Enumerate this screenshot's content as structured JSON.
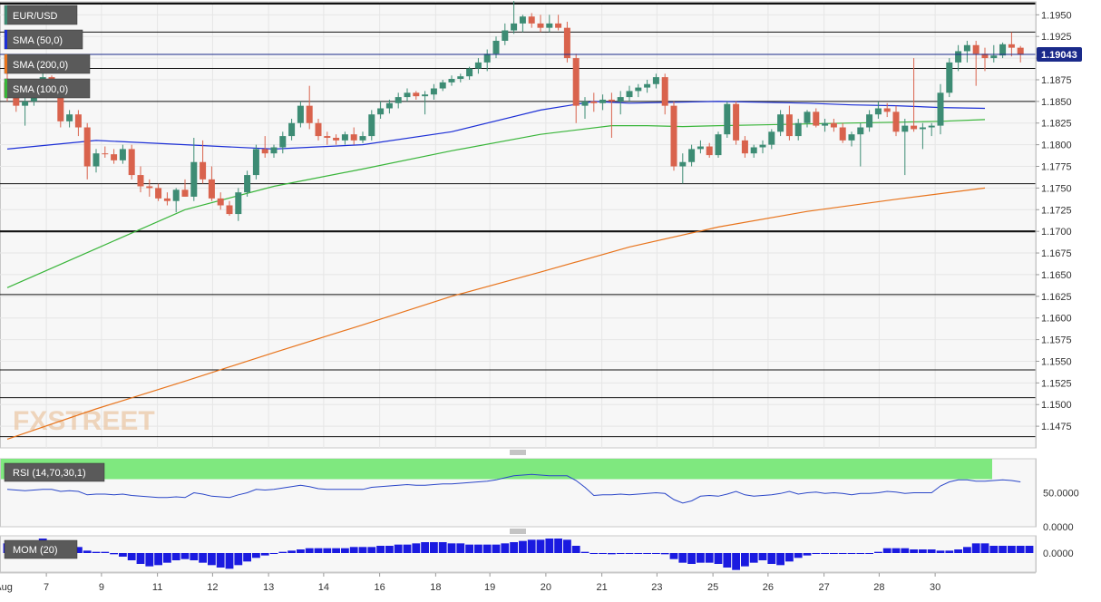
{
  "symbol": "EUR/USD",
  "price_tag": "1.19043",
  "watermark": "FXSTREET",
  "indicator_labels": {
    "sma50": "SMA (50,0)",
    "sma200": "SMA (200,0)",
    "sma100": "SMA (100,0)",
    "rsi": "RSI (14,70,30,1)",
    "mom": "MOM (20)"
  },
  "colors": {
    "bull": "#3d8c74",
    "bear": "#d9634d",
    "sma50": "#1c2fd6",
    "sma100": "#39b53a",
    "sma200": "#e8741c",
    "rsi_line": "#2a46c8",
    "rsi_overbought": "#7fe87f",
    "rsi_oversold": "#f77b7b",
    "mom_bar": "#1a1ae0",
    "price_tag_bg": "#1a2a8a"
  },
  "chart_data": {
    "type": "candlestick",
    "price_axis": {
      "min": 1.145,
      "max": 1.1965,
      "tick_labels": [
        "1.1950",
        "1.1925",
        "1.1900",
        "1.1875",
        "1.1850",
        "1.1825",
        "1.1800",
        "1.1775",
        "1.1750",
        "1.1725",
        "1.1700",
        "1.1675",
        "1.1650",
        "1.1625",
        "1.1600",
        "1.1575",
        "1.1550",
        "1.1525",
        "1.1500",
        "1.1475"
      ]
    },
    "horizontal_levels": [
      1.1963,
      1.193,
      1.1888,
      1.185,
      1.1755,
      1.17,
      1.1627,
      1.154,
      1.1508,
      1.1463
    ],
    "thick_levels": [
      1.1963,
      1.17
    ],
    "current_price": 1.19043,
    "x_labels": [
      {
        "text": "Aug",
        "i": -1.4
      },
      {
        "text": "7",
        "i": 4.4
      },
      {
        "text": "9",
        "i": 10.6
      },
      {
        "text": "11",
        "i": 16.9
      },
      {
        "text": "12",
        "i": 23.1
      },
      {
        "text": "13",
        "i": 29.4
      },
      {
        "text": "14",
        "i": 35.6
      },
      {
        "text": "16",
        "i": 41.9
      },
      {
        "text": "18",
        "i": 48.2
      },
      {
        "text": "19",
        "i": 54.3
      },
      {
        "text": "20",
        "i": 60.6
      },
      {
        "text": "21",
        "i": 66.9
      },
      {
        "text": "23",
        "i": 73.1
      },
      {
        "text": "25",
        "i": 79.4
      },
      {
        "text": "26",
        "i": 85.6
      },
      {
        "text": "27",
        "i": 91.9
      },
      {
        "text": "28",
        "i": 98.1
      },
      {
        "text": "30",
        "i": 104.4
      }
    ],
    "candles": [
      {
        "o": 1.1872,
        "h": 1.189,
        "l": 1.185,
        "c": 1.1855
      },
      {
        "o": 1.1855,
        "h": 1.1862,
        "l": 1.1838,
        "c": 1.1845
      },
      {
        "o": 1.1845,
        "h": 1.1858,
        "l": 1.1822,
        "c": 1.185
      },
      {
        "o": 1.185,
        "h": 1.1875,
        "l": 1.1845,
        "c": 1.187
      },
      {
        "o": 1.187,
        "h": 1.1885,
        "l": 1.186,
        "c": 1.1878
      },
      {
        "o": 1.1878,
        "h": 1.188,
        "l": 1.1862,
        "c": 1.1868
      },
      {
        "o": 1.1868,
        "h": 1.1875,
        "l": 1.182,
        "c": 1.1827
      },
      {
        "o": 1.1827,
        "h": 1.184,
        "l": 1.182,
        "c": 1.1835
      },
      {
        "o": 1.1835,
        "h": 1.184,
        "l": 1.181,
        "c": 1.182
      },
      {
        "o": 1.182,
        "h": 1.1825,
        "l": 1.176,
        "c": 1.1775
      },
      {
        "o": 1.1775,
        "h": 1.1795,
        "l": 1.1768,
        "c": 1.179
      },
      {
        "o": 1.179,
        "h": 1.1798,
        "l": 1.1785,
        "c": 1.1789
      },
      {
        "o": 1.1789,
        "h": 1.1795,
        "l": 1.1778,
        "c": 1.1782
      },
      {
        "o": 1.1782,
        "h": 1.18,
        "l": 1.1778,
        "c": 1.1795
      },
      {
        "o": 1.1795,
        "h": 1.18,
        "l": 1.176,
        "c": 1.1765
      },
      {
        "o": 1.1765,
        "h": 1.1775,
        "l": 1.1745,
        "c": 1.1752
      },
      {
        "o": 1.1752,
        "h": 1.176,
        "l": 1.174,
        "c": 1.175
      },
      {
        "o": 1.175,
        "h": 1.1755,
        "l": 1.1735,
        "c": 1.1738
      },
      {
        "o": 1.1738,
        "h": 1.1745,
        "l": 1.173,
        "c": 1.1735
      },
      {
        "o": 1.1735,
        "h": 1.175,
        "l": 1.1722,
        "c": 1.1748
      },
      {
        "o": 1.1748,
        "h": 1.176,
        "l": 1.174,
        "c": 1.174
      },
      {
        "o": 1.174,
        "h": 1.1808,
        "l": 1.1735,
        "c": 1.178
      },
      {
        "o": 1.178,
        "h": 1.1805,
        "l": 1.1755,
        "c": 1.176
      },
      {
        "o": 1.176,
        "h": 1.1775,
        "l": 1.1735,
        "c": 1.1738
      },
      {
        "o": 1.1738,
        "h": 1.1745,
        "l": 1.1725,
        "c": 1.173
      },
      {
        "o": 1.173,
        "h": 1.1735,
        "l": 1.1718,
        "c": 1.172
      },
      {
        "o": 1.172,
        "h": 1.175,
        "l": 1.1712,
        "c": 1.1745
      },
      {
        "o": 1.1745,
        "h": 1.177,
        "l": 1.174,
        "c": 1.1765
      },
      {
        "o": 1.1765,
        "h": 1.18,
        "l": 1.176,
        "c": 1.1795
      },
      {
        "o": 1.1795,
        "h": 1.181,
        "l": 1.1785,
        "c": 1.179
      },
      {
        "o": 1.179,
        "h": 1.18,
        "l": 1.1785,
        "c": 1.1797
      },
      {
        "o": 1.1797,
        "h": 1.1815,
        "l": 1.179,
        "c": 1.181
      },
      {
        "o": 1.181,
        "h": 1.183,
        "l": 1.1805,
        "c": 1.1825
      },
      {
        "o": 1.1825,
        "h": 1.185,
        "l": 1.182,
        "c": 1.1845
      },
      {
        "o": 1.1845,
        "h": 1.1868,
        "l": 1.1818,
        "c": 1.1825
      },
      {
        "o": 1.1825,
        "h": 1.183,
        "l": 1.1805,
        "c": 1.181
      },
      {
        "o": 1.181,
        "h": 1.1815,
        "l": 1.18,
        "c": 1.1808
      },
      {
        "o": 1.1808,
        "h": 1.1812,
        "l": 1.18,
        "c": 1.1805
      },
      {
        "o": 1.1805,
        "h": 1.1815,
        "l": 1.18,
        "c": 1.1812
      },
      {
        "o": 1.1812,
        "h": 1.182,
        "l": 1.18,
        "c": 1.1805
      },
      {
        "o": 1.1805,
        "h": 1.1815,
        "l": 1.1802,
        "c": 1.181
      },
      {
        "o": 1.181,
        "h": 1.184,
        "l": 1.1805,
        "c": 1.1835
      },
      {
        "o": 1.1835,
        "h": 1.185,
        "l": 1.183,
        "c": 1.1842
      },
      {
        "o": 1.1842,
        "h": 1.1852,
        "l": 1.1836,
        "c": 1.1848
      },
      {
        "o": 1.1848,
        "h": 1.186,
        "l": 1.1842,
        "c": 1.1855
      },
      {
        "o": 1.1855,
        "h": 1.1865,
        "l": 1.185,
        "c": 1.186
      },
      {
        "o": 1.186,
        "h": 1.1862,
        "l": 1.1852,
        "c": 1.1856
      },
      {
        "o": 1.1856,
        "h": 1.1862,
        "l": 1.1835,
        "c": 1.1858
      },
      {
        "o": 1.1858,
        "h": 1.187,
        "l": 1.1852,
        "c": 1.1865
      },
      {
        "o": 1.1865,
        "h": 1.1875,
        "l": 1.1862,
        "c": 1.1872
      },
      {
        "o": 1.1872,
        "h": 1.188,
        "l": 1.1868,
        "c": 1.1876
      },
      {
        "o": 1.1876,
        "h": 1.1882,
        "l": 1.1872,
        "c": 1.1879
      },
      {
        "o": 1.1879,
        "h": 1.189,
        "l": 1.1875,
        "c": 1.1888
      },
      {
        "o": 1.1888,
        "h": 1.19,
        "l": 1.1882,
        "c": 1.1895
      },
      {
        "o": 1.1895,
        "h": 1.191,
        "l": 1.1885,
        "c": 1.1905
      },
      {
        "o": 1.1905,
        "h": 1.1925,
        "l": 1.19,
        "c": 1.192
      },
      {
        "o": 1.192,
        "h": 1.194,
        "l": 1.1915,
        "c": 1.1932
      },
      {
        "o": 1.1932,
        "h": 1.1966,
        "l": 1.1928,
        "c": 1.194
      },
      {
        "o": 1.194,
        "h": 1.195,
        "l": 1.193,
        "c": 1.1948
      },
      {
        "o": 1.1948,
        "h": 1.1952,
        "l": 1.1935,
        "c": 1.194
      },
      {
        "o": 1.194,
        "h": 1.195,
        "l": 1.193,
        "c": 1.1935
      },
      {
        "o": 1.1935,
        "h": 1.195,
        "l": 1.193,
        "c": 1.194
      },
      {
        "o": 1.194,
        "h": 1.195,
        "l": 1.1932,
        "c": 1.1935
      },
      {
        "o": 1.1935,
        "h": 1.1942,
        "l": 1.1895,
        "c": 1.19
      },
      {
        "o": 1.19,
        "h": 1.1905,
        "l": 1.1825,
        "c": 1.1845
      },
      {
        "o": 1.1845,
        "h": 1.1855,
        "l": 1.183,
        "c": 1.185
      },
      {
        "o": 1.185,
        "h": 1.186,
        "l": 1.1838,
        "c": 1.1848
      },
      {
        "o": 1.1848,
        "h": 1.1858,
        "l": 1.184,
        "c": 1.1852
      },
      {
        "o": 1.1852,
        "h": 1.186,
        "l": 1.1808,
        "c": 1.185
      },
      {
        "o": 1.185,
        "h": 1.1862,
        "l": 1.1835,
        "c": 1.1855
      },
      {
        "o": 1.1855,
        "h": 1.1868,
        "l": 1.185,
        "c": 1.1862
      },
      {
        "o": 1.1862,
        "h": 1.187,
        "l": 1.1855,
        "c": 1.1866
      },
      {
        "o": 1.1866,
        "h": 1.1875,
        "l": 1.186,
        "c": 1.187
      },
      {
        "o": 1.187,
        "h": 1.1882,
        "l": 1.1865,
        "c": 1.1878
      },
      {
        "o": 1.1878,
        "h": 1.1882,
        "l": 1.1835,
        "c": 1.1845
      },
      {
        "o": 1.1845,
        "h": 1.185,
        "l": 1.177,
        "c": 1.1775
      },
      {
        "o": 1.1775,
        "h": 1.179,
        "l": 1.1755,
        "c": 1.178
      },
      {
        "o": 1.178,
        "h": 1.18,
        "l": 1.1775,
        "c": 1.1795
      },
      {
        "o": 1.1795,
        "h": 1.1805,
        "l": 1.179,
        "c": 1.1798
      },
      {
        "o": 1.1798,
        "h": 1.1802,
        "l": 1.1785,
        "c": 1.1788
      },
      {
        "o": 1.1788,
        "h": 1.1815,
        "l": 1.1785,
        "c": 1.1812
      },
      {
        "o": 1.1812,
        "h": 1.185,
        "l": 1.1808,
        "c": 1.1847
      },
      {
        "o": 1.1847,
        "h": 1.185,
        "l": 1.18,
        "c": 1.1805
      },
      {
        "o": 1.1805,
        "h": 1.181,
        "l": 1.1785,
        "c": 1.179
      },
      {
        "o": 1.179,
        "h": 1.18,
        "l": 1.1785,
        "c": 1.1797
      },
      {
        "o": 1.1797,
        "h": 1.1805,
        "l": 1.179,
        "c": 1.18
      },
      {
        "o": 1.18,
        "h": 1.1818,
        "l": 1.1795,
        "c": 1.1815
      },
      {
        "o": 1.1815,
        "h": 1.184,
        "l": 1.181,
        "c": 1.1835
      },
      {
        "o": 1.1835,
        "h": 1.1845,
        "l": 1.1805,
        "c": 1.181
      },
      {
        "o": 1.181,
        "h": 1.183,
        "l": 1.1805,
        "c": 1.1825
      },
      {
        "o": 1.1825,
        "h": 1.184,
        "l": 1.182,
        "c": 1.1838
      },
      {
        "o": 1.1838,
        "h": 1.1842,
        "l": 1.182,
        "c": 1.1822
      },
      {
        "o": 1.1822,
        "h": 1.183,
        "l": 1.1815,
        "c": 1.1825
      },
      {
        "o": 1.1825,
        "h": 1.183,
        "l": 1.1815,
        "c": 1.182
      },
      {
        "o": 1.182,
        "h": 1.1825,
        "l": 1.1802,
        "c": 1.1805
      },
      {
        "o": 1.1805,
        "h": 1.1815,
        "l": 1.1798,
        "c": 1.1812
      },
      {
        "o": 1.1812,
        "h": 1.1825,
        "l": 1.1775,
        "c": 1.182
      },
      {
        "o": 1.182,
        "h": 1.184,
        "l": 1.1815,
        "c": 1.1835
      },
      {
        "o": 1.1835,
        "h": 1.185,
        "l": 1.183,
        "c": 1.1842
      },
      {
        "o": 1.1842,
        "h": 1.1848,
        "l": 1.1832,
        "c": 1.1838
      },
      {
        "o": 1.1838,
        "h": 1.1845,
        "l": 1.181,
        "c": 1.1815
      },
      {
        "o": 1.1815,
        "h": 1.183,
        "l": 1.1765,
        "c": 1.1822
      },
      {
        "o": 1.1822,
        "h": 1.19,
        "l": 1.1815,
        "c": 1.1818
      },
      {
        "o": 1.1818,
        "h": 1.1825,
        "l": 1.1795,
        "c": 1.182
      },
      {
        "o": 1.182,
        "h": 1.1825,
        "l": 1.181,
        "c": 1.1822
      },
      {
        "o": 1.1822,
        "h": 1.187,
        "l": 1.1812,
        "c": 1.186
      },
      {
        "o": 1.186,
        "h": 1.19,
        "l": 1.1855,
        "c": 1.1895
      },
      {
        "o": 1.1895,
        "h": 1.1915,
        "l": 1.1885,
        "c": 1.1908
      },
      {
        "o": 1.1908,
        "h": 1.192,
        "l": 1.1895,
        "c": 1.1915
      },
      {
        "o": 1.1915,
        "h": 1.192,
        "l": 1.1868,
        "c": 1.1905
      },
      {
        "o": 1.1905,
        "h": 1.1912,
        "l": 1.1885,
        "c": 1.19
      },
      {
        "o": 1.19,
        "h": 1.1915,
        "l": 1.1895,
        "c": 1.1903
      },
      {
        "o": 1.1903,
        "h": 1.1918,
        "l": 1.19,
        "c": 1.1916
      },
      {
        "o": 1.1916,
        "h": 1.193,
        "l": 1.1902,
        "c": 1.1912
      },
      {
        "o": 1.1912,
        "h": 1.1914,
        "l": 1.1895,
        "c": 1.1904
      }
    ],
    "sma50": {
      "x": [
        0,
        10,
        20,
        30,
        40,
        50,
        60,
        66,
        70,
        75,
        80,
        85,
        90,
        95,
        100,
        105,
        110
      ],
      "y": [
        1.1795,
        1.1805,
        1.18,
        1.1795,
        1.18,
        1.1815,
        1.184,
        1.185,
        1.1848,
        1.1849,
        1.185,
        1.1849,
        1.1848,
        1.1846,
        1.1845,
        1.1843,
        1.1842
      ]
    },
    "sma100": {
      "x": [
        0,
        10,
        20,
        30,
        40,
        50,
        60,
        68,
        72,
        76,
        80,
        85,
        90,
        95,
        100,
        105,
        110
      ],
      "y": [
        1.1635,
        1.168,
        1.1725,
        1.1752,
        1.1772,
        1.1793,
        1.1812,
        1.1822,
        1.1822,
        1.1821,
        1.1822,
        1.1823,
        1.1824,
        1.1825,
        1.1826,
        1.1827,
        1.1829
      ]
    },
    "sma200": {
      "x": [
        0,
        10,
        20,
        30,
        40,
        50,
        60,
        70,
        80,
        90,
        100,
        110
      ],
      "y": [
        1.146,
        1.1495,
        1.1527,
        1.156,
        1.1592,
        1.1625,
        1.1653,
        1.1682,
        1.1705,
        1.1723,
        1.1737,
        1.175
      ]
    },
    "rsi": {
      "scale_labels": [
        "50.0000",
        "0.0000"
      ],
      "min": 0,
      "max": 100,
      "overbought": 70,
      "oversold": 30,
      "values": [
        55,
        54,
        53,
        54,
        55,
        55,
        52,
        53,
        52,
        47,
        48,
        48,
        47,
        48,
        46,
        45,
        44,
        43,
        43,
        44,
        43,
        50,
        48,
        45,
        44,
        43,
        47,
        50,
        55,
        54,
        55,
        57,
        59,
        61,
        59,
        56,
        55,
        55,
        55,
        55,
        55,
        58,
        59,
        60,
        61,
        62,
        61,
        61,
        62,
        63,
        63,
        64,
        65,
        66,
        67,
        69,
        72,
        75,
        76,
        77,
        76,
        75,
        75,
        75,
        68,
        58,
        46,
        47,
        47,
        48,
        47,
        48,
        49,
        50,
        49,
        40,
        35,
        38,
        45,
        46,
        45,
        48,
        52,
        47,
        45,
        46,
        47,
        49,
        52,
        48,
        50,
        51,
        49,
        50,
        49,
        47,
        49,
        49,
        50,
        52,
        51,
        49,
        50,
        50,
        50,
        60,
        66,
        69,
        69,
        67,
        67,
        68,
        69,
        68,
        66
      ]
    },
    "momentum": {
      "scale_label": "0.0000",
      "values": [
        0.0008,
        0.0008,
        0.0009,
        0.001,
        0.0012,
        0.001,
        0.0008,
        0.0006,
        0.0005,
        0.0002,
        0.0001,
        0.0001,
        -0.0001,
        -0.0003,
        -0.0006,
        -0.0009,
        -0.0011,
        -0.001,
        -0.0008,
        -0.0006,
        -0.0005,
        -0.0006,
        -0.0008,
        -0.001,
        -0.0012,
        -0.0013,
        -0.001,
        -0.0007,
        -0.0004,
        -0.0002,
        0.0,
        0.0001,
        0.0002,
        0.0003,
        0.0004,
        0.0004,
        0.0004,
        0.0004,
        0.0004,
        0.0005,
        0.0005,
        0.0005,
        0.0006,
        0.0006,
        0.0007,
        0.0007,
        0.0008,
        0.0009,
        0.0009,
        0.0009,
        0.0008,
        0.0008,
        0.0007,
        0.0007,
        0.0007,
        0.0007,
        0.0008,
        0.0009,
        0.001,
        0.0011,
        0.0011,
        0.0012,
        0.0012,
        0.0011,
        0.0006,
        0.0001,
        0.0,
        0.0,
        -0.0001,
        0.0,
        0.0,
        0.0,
        0.0,
        0.0,
        -0.0001,
        -0.0005,
        -0.0008,
        -0.0009,
        -0.0008,
        -0.0008,
        -0.0009,
        -0.0012,
        -0.0014,
        -0.0011,
        -0.0008,
        -0.0006,
        -0.0009,
        -0.001,
        -0.0007,
        -0.0004,
        -0.0002,
        0.0,
        0.0,
        0.0,
        0.0,
        0.0,
        0.0,
        0.0,
        0.0001,
        0.0004,
        0.0004,
        0.0004,
        0.0003,
        0.0003,
        0.0003,
        0.0002,
        0.0002,
        0.0003,
        0.0005,
        0.0008,
        0.0008,
        0.0006,
        0.0006,
        0.0006,
        0.0006,
        0.0006
      ]
    }
  }
}
